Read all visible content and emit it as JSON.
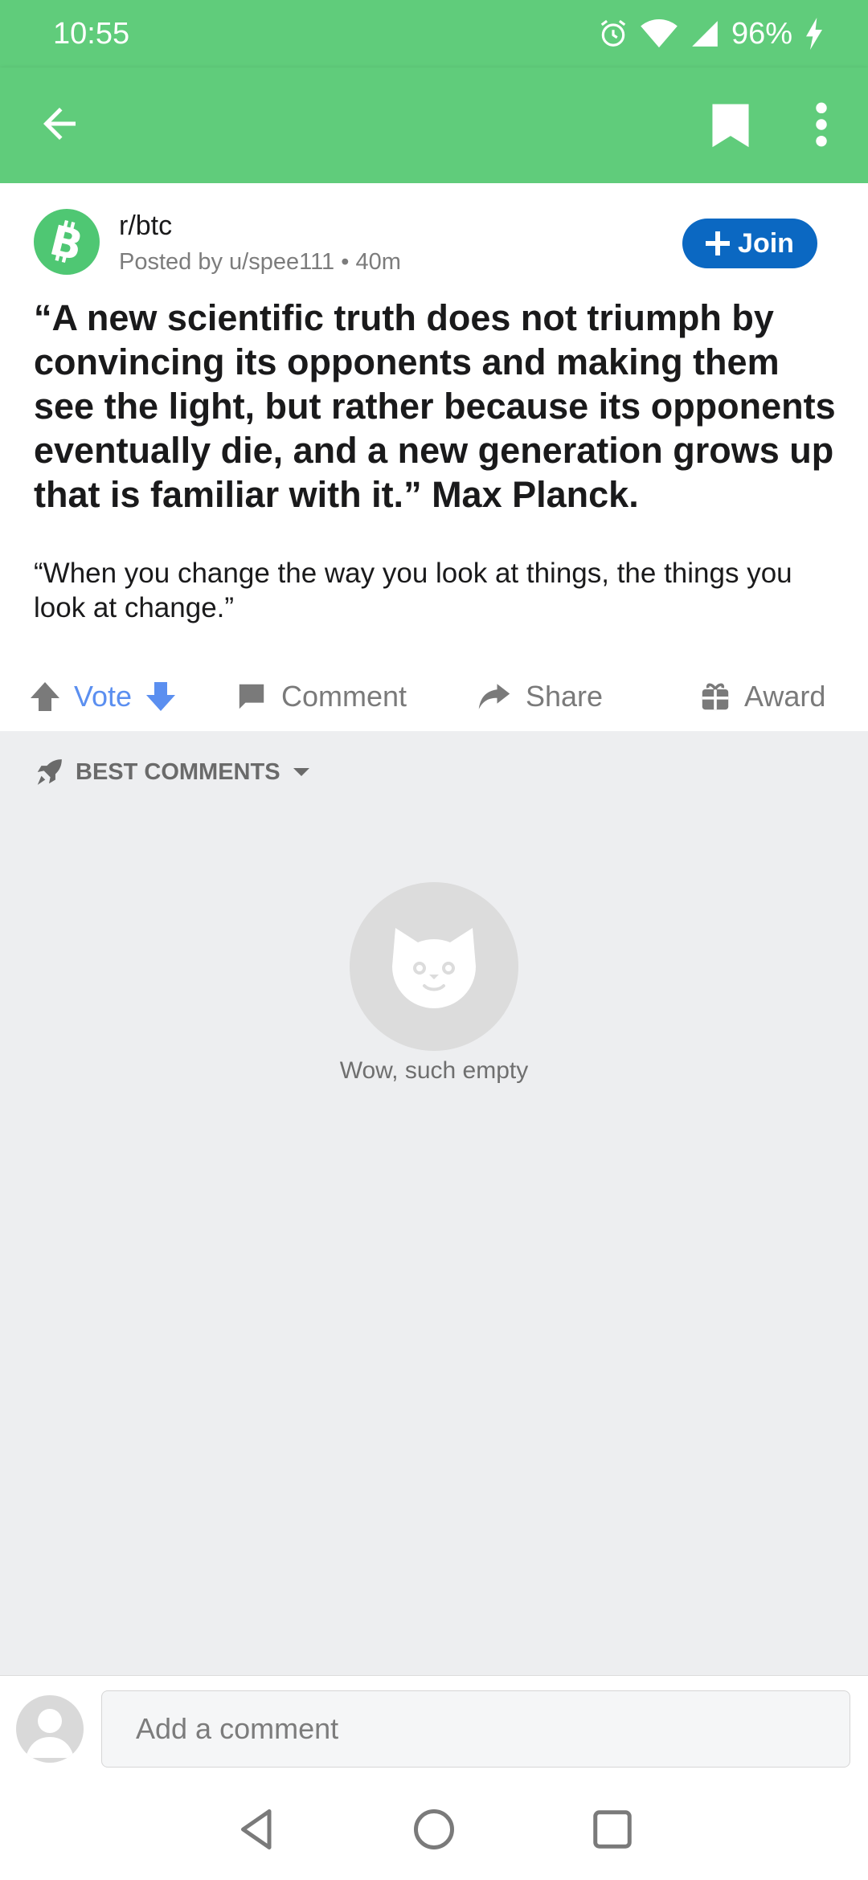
{
  "status_bar": {
    "time": "10:55",
    "battery": "96%",
    "icons": [
      "alarm-icon",
      "wifi-icon",
      "signal-icon",
      "charging-icon"
    ]
  },
  "app_bar": {
    "icons": [
      "back-arrow-icon",
      "bookmark-icon",
      "more-vert-icon"
    ]
  },
  "post": {
    "subreddit": "r/btc",
    "posted_by": "Posted by u/spee111 • 40m",
    "join_label": "Join",
    "title": "“A new scientific truth does not triumph by convincing its opponents and making them see the light, but rather because its opponents eventually die, and a new generation grows up that is familiar with it.” Max Planck.",
    "body": "“When you change the way you look at things, the things you look at change.”"
  },
  "actions": {
    "vote": "Vote",
    "comment": "Comment",
    "share": "Share",
    "award": "Award"
  },
  "comments": {
    "sort_label": "BEST COMMENTS",
    "empty_text": "Wow, such empty"
  },
  "comment_bar": {
    "placeholder": "Add a comment"
  },
  "colors": {
    "brand_green": "#60cc7b",
    "join_blue": "#0b68c2",
    "vote_blue": "#5b8ff0"
  }
}
